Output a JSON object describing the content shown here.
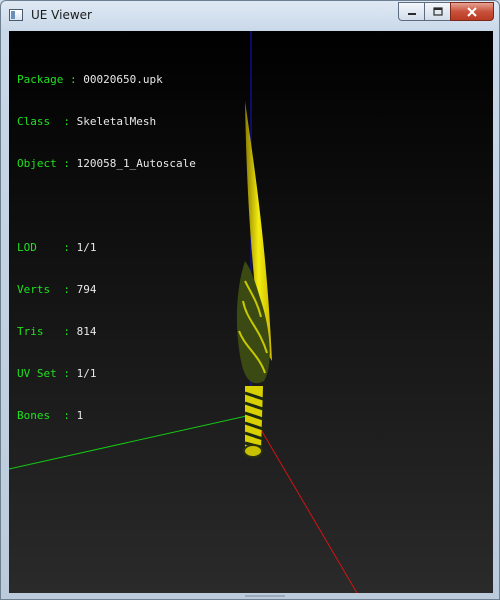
{
  "window": {
    "title": "UE Viewer",
    "icon": "app-window-icon",
    "buttons": [
      {
        "name": "minimize",
        "icon": "minimize-icon"
      },
      {
        "name": "maximize",
        "icon": "maximize-icon"
      },
      {
        "name": "close",
        "icon": "close-icon"
      }
    ]
  },
  "hud": {
    "package": {
      "label": "Package",
      "value": "00020650.upk"
    },
    "class": {
      "label": "Class  ",
      "value": "SkeletalMesh"
    },
    "object": {
      "label": "Object ",
      "value": "120058_1_Autoscale"
    },
    "lod": {
      "label": "LOD    ",
      "value": "1/1"
    },
    "verts": {
      "label": "Verts  ",
      "value": "794"
    },
    "tris": {
      "label": "Tris   ",
      "value": "814"
    },
    "uvset": {
      "label": "UV Set ",
      "value": "1/1"
    },
    "bones": {
      "label": "Bones  ",
      "value": "1"
    }
  },
  "colors": {
    "label": "#20e020",
    "value": "#e8e8e8",
    "axis_x": "#d01010",
    "axis_y": "#10c010",
    "axis_z": "#1010d0",
    "mesh": "#e8e000"
  }
}
